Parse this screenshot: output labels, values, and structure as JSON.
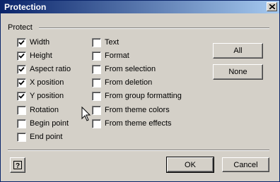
{
  "window": {
    "title": "Protection"
  },
  "protect_group": {
    "label": "Protect",
    "left_column": [
      {
        "label": "Width",
        "checked": true
      },
      {
        "label": "Height",
        "checked": true
      },
      {
        "label": "Aspect ratio",
        "checked": true
      },
      {
        "label": "X position",
        "checked": true
      },
      {
        "label": "Y position",
        "checked": true
      },
      {
        "label": "Rotation",
        "checked": false
      },
      {
        "label": "Begin point",
        "checked": false
      },
      {
        "label": "End point",
        "checked": false
      }
    ],
    "right_column": [
      {
        "label": "Text",
        "checked": false
      },
      {
        "label": "Format",
        "checked": false
      },
      {
        "label": "From selection",
        "checked": false
      },
      {
        "label": "From deletion",
        "checked": false
      },
      {
        "label": "From group formatting",
        "checked": false
      },
      {
        "label": "From theme colors",
        "checked": false
      },
      {
        "label": "From theme effects",
        "checked": false
      }
    ]
  },
  "buttons": {
    "all": "All",
    "none": "None",
    "ok": "OK",
    "cancel": "Cancel"
  },
  "icons": {
    "close": "close-icon",
    "help": "help-icon",
    "cursor": "mouse-pointer-icon"
  }
}
